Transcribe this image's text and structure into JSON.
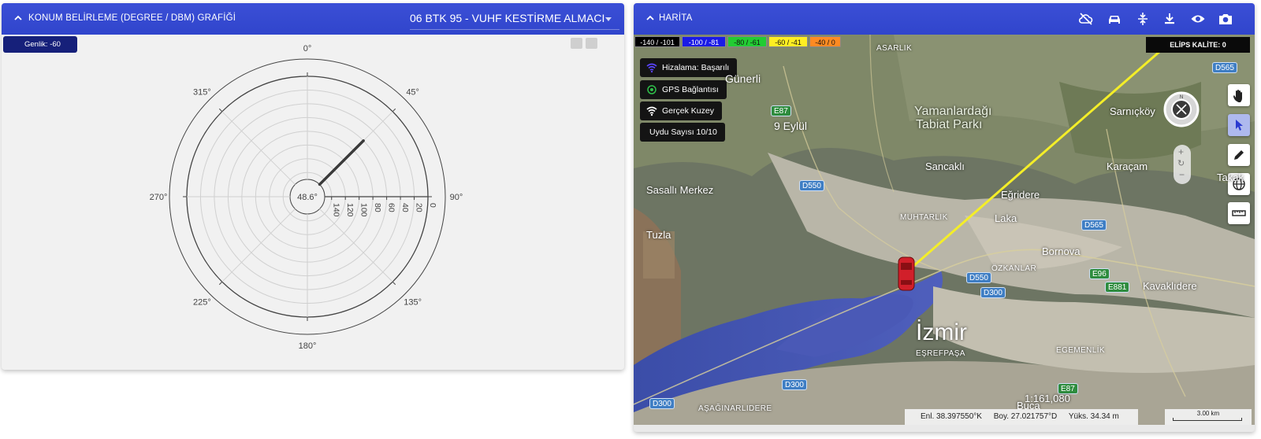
{
  "left_panel": {
    "title": "KONUM BELİRLEME (DEGREE / DBM) GRAFİĞİ",
    "receiver_select": "06 BTK 95 - VUHF KESTİRME ALMACI",
    "amplitude_badge": "Genlik: -60"
  },
  "chart_data": {
    "type": "polar",
    "center_label": "48.6°",
    "bearing_deg": 45,
    "signal_dbm": -60,
    "angular_ticks": [
      "0°",
      "45°",
      "90°",
      "135°",
      "180°",
      "225°",
      "270°",
      "315°"
    ],
    "radial_ticks": [
      140,
      120,
      100,
      80,
      60,
      40,
      20,
      0
    ],
    "radial_range": [
      -150,
      0
    ]
  },
  "right_panel": {
    "title": "HARİTA",
    "toolbar": [
      "cloud-off-icon",
      "car-icon",
      "collapse-vertical-icon",
      "download-icon",
      "eye-icon",
      "camera-icon"
    ],
    "legend": [
      {
        "label": "-140 / -101",
        "bg": "#000000",
        "fg": "#ffffff"
      },
      {
        "label": "-100 / -81",
        "bg": "#1a1ae6",
        "fg": "#ffffff"
      },
      {
        "label": "-80 / -61",
        "bg": "#22cc33",
        "fg": "#111111"
      },
      {
        "label": "-60 / -41",
        "bg": "#ffee22",
        "fg": "#111111"
      },
      {
        "label": "-40 / 0",
        "bg": "#ff8a22",
        "fg": "#111111"
      }
    ],
    "ellipse_quality": "ELİPS KALİTE: 0",
    "status": {
      "alignment": "Hizalama: Başarılı",
      "gps": "GPS Bağlantısı",
      "north": "Gerçek Kuzey",
      "satellites": "Uydu Sayısı 10/10"
    },
    "map_labels": {
      "asarlik": "ASARLIK",
      "gunerli": "Günerli",
      "eylul": "9 Eylül",
      "yamanlar": "Yamanlardağı",
      "tabiat": "Tabiat Parkı",
      "sarnickoy": "Sarnıçköy",
      "sancakli": "Sancaklı",
      "karacam": "Karaçam",
      "takak": "Takak",
      "sasalli": "Sasallı Merkez",
      "egridere": "Eğridere",
      "tuzla": "Tuzla",
      "muhtarlik": "MUHTARLIK",
      "laka": "Laka",
      "bornova": "Bornova",
      "ozkanlar": "ÖZKANLAR",
      "kavaklidere": "Kavaklıdere",
      "izmir": "İzmir",
      "esrefpasa": "EŞREFPAŞA",
      "egemenlik": "EGEMENLİK",
      "asaginarlidere": "AŞAĞINARLIDERE",
      "buca": "Buca"
    },
    "road_shields": {
      "e87a": "E87",
      "d550a": "D550",
      "d565a": "D565",
      "d565b": "D565",
      "d550b": "D550",
      "d300a": "D300",
      "e96": "E96",
      "e881": "E881",
      "d300b": "D300",
      "d300c": "D300",
      "e87b": "E87"
    },
    "scale_ratio": "1:161,080",
    "coords": {
      "lat": "Enl.  38.397550°K",
      "lon": "Boy.  27.021757°D",
      "alt": "Yüks.  34.34 m"
    },
    "scale_label": "3.00 km",
    "tools": [
      "hand-icon",
      "pointer-icon",
      "pencil-icon",
      "globe-icon",
      "ruler-icon"
    ]
  }
}
